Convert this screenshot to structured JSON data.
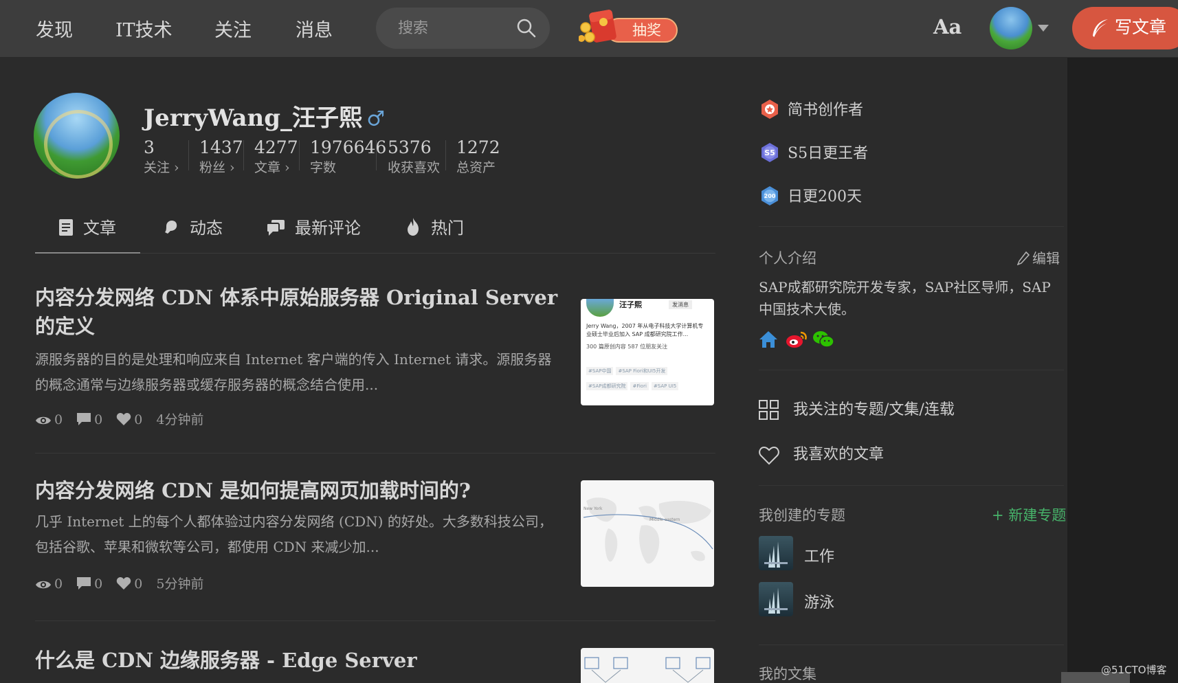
{
  "nav": {
    "items": [
      {
        "label": "发现"
      },
      {
        "label": "IT技术"
      },
      {
        "label": "关注"
      },
      {
        "label": "消息"
      }
    ],
    "search_placeholder": "搜索",
    "lottery_label": "抽奖",
    "font_toggle": "Aa",
    "write_label": "写文章"
  },
  "profile": {
    "name": "JerryWang_汪子熙",
    "gender_icon": "♂",
    "stats": [
      {
        "value": "3",
        "label": "关注 ›"
      },
      {
        "value": "1437",
        "label": "粉丝 ›"
      },
      {
        "value": "4277",
        "label": "文章 ›"
      },
      {
        "value": "1976646",
        "label": "字数"
      },
      {
        "value": "5376",
        "label": "收获喜欢"
      },
      {
        "value": "1272",
        "label": "总资产"
      }
    ]
  },
  "tabs": [
    {
      "label": "文章",
      "icon": "document-icon"
    },
    {
      "label": "动态",
      "icon": "bell-icon"
    },
    {
      "label": "最新评论",
      "icon": "comments-icon"
    },
    {
      "label": "热门",
      "icon": "fire-icon"
    }
  ],
  "articles": [
    {
      "title": "内容分发网络 CDN 体系中原始服务器 Original Server 的定义",
      "abstract": "源服务器的目的是处理和响应来自 Internet 客户端的传入 Internet 请求。源服务器的概念通常与边缘服务器或缓存服务器的概念结合使用...",
      "views": "0",
      "comments": "0",
      "likes": "0",
      "time": "4分钟前",
      "thumb": {
        "name": "汪子熙",
        "send": "发消息",
        "bio": "Jerry Wang，2007 年从电子科技大学计算机专业硕士毕业后加入 SAP 成都研究院工作...",
        "counts": "300 篇原创内容  587 位朋友关注",
        "tags": [
          "#SAP中国",
          "#SAP Fiori和UI5开发",
          "#SAP成都研究院",
          "#Fiori",
          "#SAP UI5"
        ]
      }
    },
    {
      "title": "内容分发网络 CDN 是如何提高网页加载时间的?",
      "abstract": "几乎 Internet 上的每个人都体验过内容分发网络 (CDN) 的好处。大多数科技公司，包括谷歌、苹果和微软等公司，都使用 CDN 来减少加...",
      "views": "0",
      "comments": "0",
      "likes": "0",
      "time": "5分钟前",
      "thumb": {
        "city_a": "New York",
        "city_b": "Middle eastern"
      }
    },
    {
      "title": "什么是 CDN 边缘服务器 - Edge Server"
    }
  ],
  "sidebar": {
    "badges": [
      {
        "label": "简书创作者",
        "icon": "author-badge-icon",
        "color": "#e8604a"
      },
      {
        "label": "S5日更王者",
        "icon": "s5-badge-icon",
        "color": "#6b6fd8"
      },
      {
        "label": "日更200天",
        "icon": "200-badge-icon",
        "color": "#4a8fd8"
      }
    ],
    "intro_title": "个人介绍",
    "edit_label": "编辑",
    "intro_text": "SAP成都研究院开发专家，SAP社区导师，SAP中国技术大使。",
    "followed_label": "我关注的专题/文集/连载",
    "liked_label": "我喜欢的文章",
    "topics_title": "我创建的专题",
    "new_topic_label": "+ 新建专题",
    "topics": [
      {
        "label": "工作"
      },
      {
        "label": "游泳"
      }
    ],
    "collections_title": "我的文集"
  },
  "watermark": "@51CTO博客"
}
